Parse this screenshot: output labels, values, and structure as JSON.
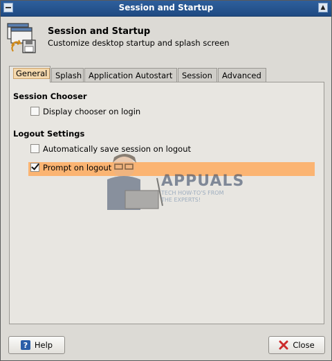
{
  "window": {
    "title": "Session and Startup"
  },
  "header": {
    "title": "Session and Startup",
    "subtitle": "Customize desktop startup and splash screen"
  },
  "tabs": [
    {
      "label": "General",
      "active": true
    },
    {
      "label": "Splash",
      "active": false
    },
    {
      "label": "Application Autostart",
      "active": false
    },
    {
      "label": "Session",
      "active": false
    },
    {
      "label": "Advanced",
      "active": false
    }
  ],
  "session_chooser": {
    "heading": "Session Chooser",
    "display_chooser": {
      "label": "Display chooser on login",
      "checked": false
    }
  },
  "logout_settings": {
    "heading": "Logout Settings",
    "auto_save": {
      "label": "Automatically save session on logout",
      "checked": false
    },
    "prompt": {
      "label": "Prompt on logout",
      "checked": true
    }
  },
  "watermark": {
    "brand": "APPUALS",
    "tagline_1": "TECH HOW-TO'S FROM",
    "tagline_2": "THE EXPERTS!"
  },
  "buttons": {
    "help": "Help",
    "close": "Close"
  },
  "colors": {
    "titlebar": "#1f4a82",
    "highlight": "#fbb472",
    "help_icon": "#2a5ea8",
    "close_icon": "#cc2b2b"
  },
  "icons": [
    "session-startup-icon",
    "help-icon",
    "close-icon"
  ]
}
